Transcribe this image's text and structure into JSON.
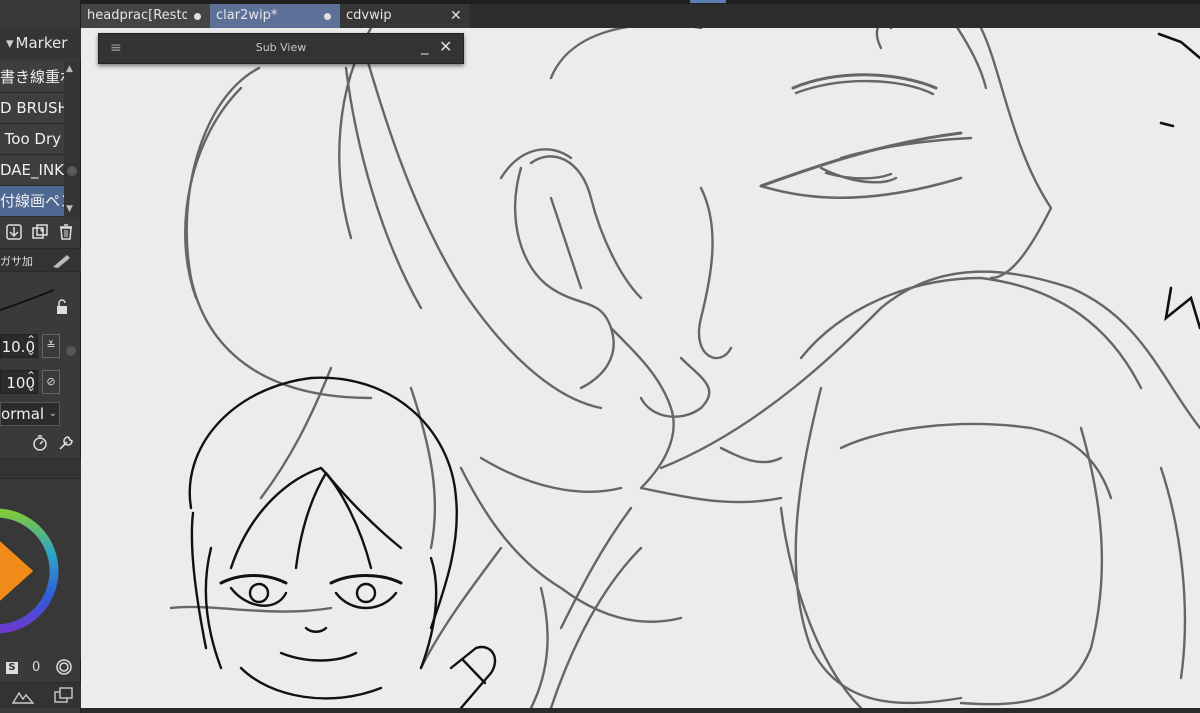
{
  "tabs": [
    {
      "label": "headprac[Restore",
      "state": "inactive",
      "indicator": "dot"
    },
    {
      "label": "clar2wip*",
      "state": "active",
      "indicator": "dot"
    },
    {
      "label": "cdvwip",
      "state": "plain",
      "indicator": "close"
    }
  ],
  "sub_view": {
    "title": "Sub View",
    "menu_icon": "hamburger-icon",
    "minimize_icon": "minimize-icon",
    "close_icon": "close-icon"
  },
  "tool_panel": {
    "title": "Marker",
    "brushes": [
      {
        "label": "書き線重ね",
        "selected": false
      },
      {
        "label": "D BRUSH",
        "selected": false
      },
      {
        "label": "Too Dry",
        "selected": false
      },
      {
        "label": "DAE_INK",
        "selected": false
      },
      {
        "label": "付線画ペン",
        "selected": true
      }
    ],
    "sub_tab_label": "ガサ加",
    "size_value": "10.0",
    "opacity_value": "100",
    "blend_mode": "ormal",
    "bottom_label": "S",
    "bottom_value": "0"
  },
  "colors": {
    "accent": "#5d7198",
    "selected_brush": "#4f6891",
    "panel_bg": "#3a3a3a",
    "canvas_bg": "#ececec",
    "sketch_gray": "#666666",
    "sketch_black": "#111111",
    "wheel_orange": "#f08a18"
  }
}
